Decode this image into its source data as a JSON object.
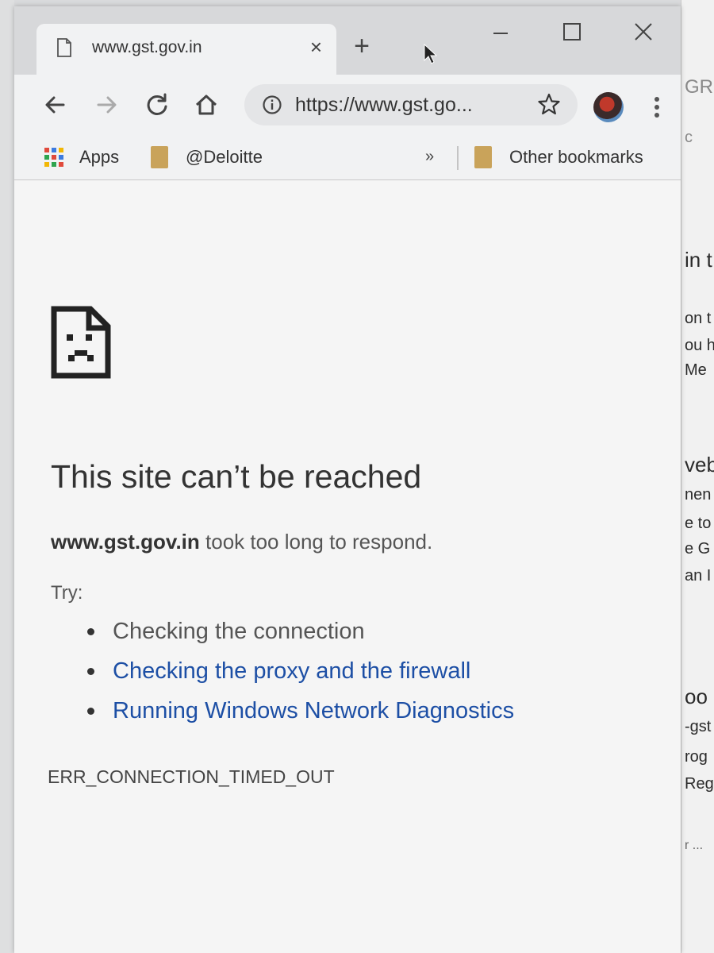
{
  "tab": {
    "title": "www.gst.gov.in",
    "close": "×"
  },
  "new_tab": "+",
  "toolbar": {
    "url": "https://www.gst.go..."
  },
  "bookmarks": {
    "apps": "Apps",
    "deloitte": "@Deloitte",
    "overflow": "»",
    "other": "Other bookmarks"
  },
  "error": {
    "title": "This site can’t be reached",
    "host": "www.gst.gov.in",
    "message_rest": " took too long to respond.",
    "try_label": "Try:",
    "suggestions": [
      "Checking the connection",
      "Checking the proxy and the firewall",
      "Running Windows Network Diagnostics"
    ],
    "code": "ERR_CONNECTION_TIMED_OUT"
  },
  "background_fragments": {
    "f1": "GR",
    "f2": "c",
    "f3": "in t",
    "f4": "on t",
    "f5": "ou h",
    "f6": "Me",
    "f7": "veb",
    "f8": "nen",
    "f9": "e to",
    "f10": "e G",
    "f11": "an I",
    "f12": "oo",
    "f13": "-gst",
    "f14": "rog",
    "f15": "Regi",
    "f16": "r ..."
  },
  "colors": {
    "link": "#1d4fa5",
    "text": "#333333",
    "chrome_frame": "#d7d8da"
  },
  "icons": {
    "sad_page": "sad-page-icon",
    "info": "info-icon",
    "star": "star-icon"
  }
}
